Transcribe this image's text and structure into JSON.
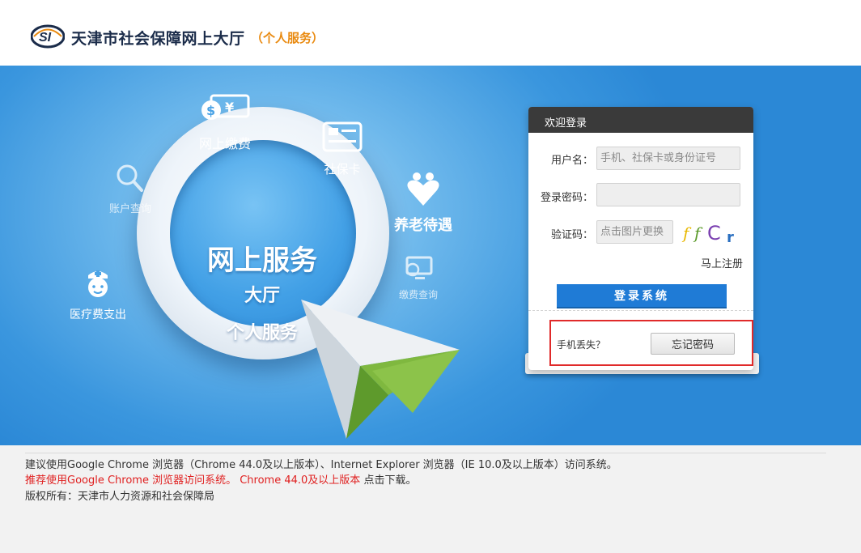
{
  "header": {
    "logo_text": "SI",
    "title": "天津市社会保障网上大厅",
    "subtitle": "（个人服务）"
  },
  "banner": {
    "center_line1": "网上服务",
    "center_line2": "大厅",
    "center_line3": "个人服务",
    "features": {
      "online_payment": "网上缴费",
      "social_card": "社保卡",
      "account_query": "账户查询",
      "pension": "养老待遇",
      "payment_query": "缴费查询",
      "medical_expense": "医疗费支出"
    }
  },
  "login": {
    "title": "欢迎登录",
    "username_label": "用户名：",
    "username_placeholder": "手机、社保卡或身份证号",
    "password_label": "登录密码：",
    "captcha_label": "验证码：",
    "captcha_placeholder": "点击图片更换",
    "captcha_text": "ffCr",
    "register_link": "马上注册",
    "login_button": "登录系统",
    "phone_lost": "手机丢失？",
    "forget_button": "忘记密码"
  },
  "footer": {
    "line1": "建议使用Google Chrome 浏览器（Chrome 44.0及以上版本）、Internet Explorer 浏览器（IE 10.0及以上版本）访问系统。",
    "line2_red": "推荐使用Google Chrome 浏览器访问系统。 Chrome 44.0及以上版本",
    "line2_download": " 点击下载。",
    "line3": "版权所有：天津市人力资源和社会保障局"
  },
  "colors": {
    "accent_orange": "#e98a10",
    "banner_blue": "#3a96de",
    "login_button": "#1f7bd6",
    "highlight_red": "#e02a2a"
  }
}
